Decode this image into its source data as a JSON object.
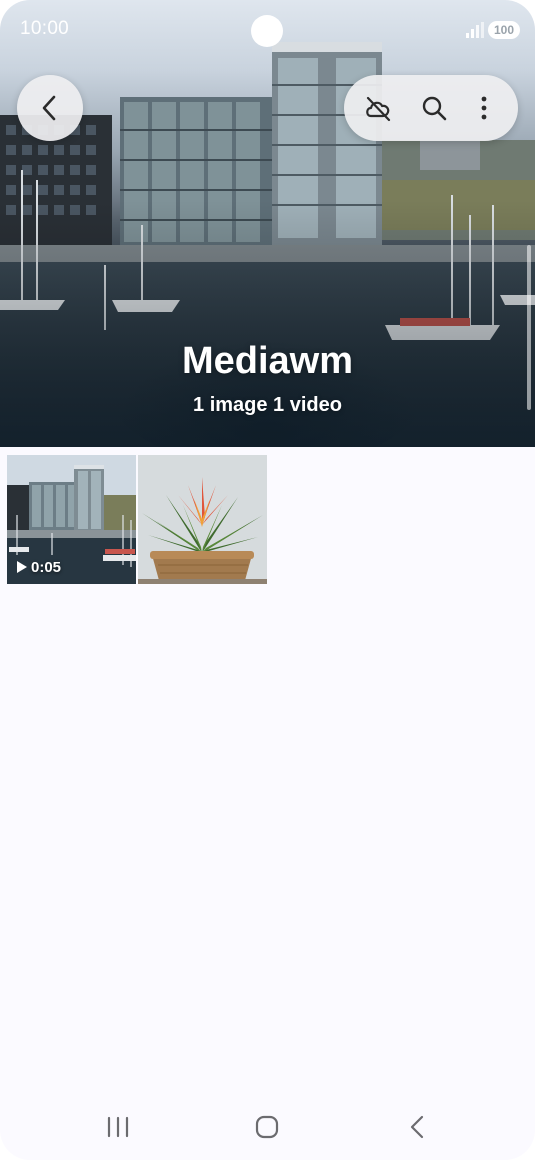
{
  "status_bar": {
    "time": "10:00",
    "battery": "100"
  },
  "header": {
    "back_icon": "chevron-left-icon",
    "actions": [
      {
        "name": "cloud-off-icon"
      },
      {
        "name": "search-icon"
      },
      {
        "name": "more-vert-icon"
      }
    ],
    "title": "Mediawm",
    "subtitle": "1 image 1 video"
  },
  "grid": {
    "items": [
      {
        "type": "video",
        "duration": "0:05",
        "subject": "harbor-buildings"
      },
      {
        "type": "image",
        "subject": "potted-bromeliad"
      }
    ]
  },
  "nav_bar": {
    "buttons": [
      "recents-icon",
      "home-icon",
      "back-icon"
    ]
  },
  "colors": {
    "background": "#fbfaff",
    "pill": "#eeeef0",
    "icon": "#2b2b2b"
  }
}
